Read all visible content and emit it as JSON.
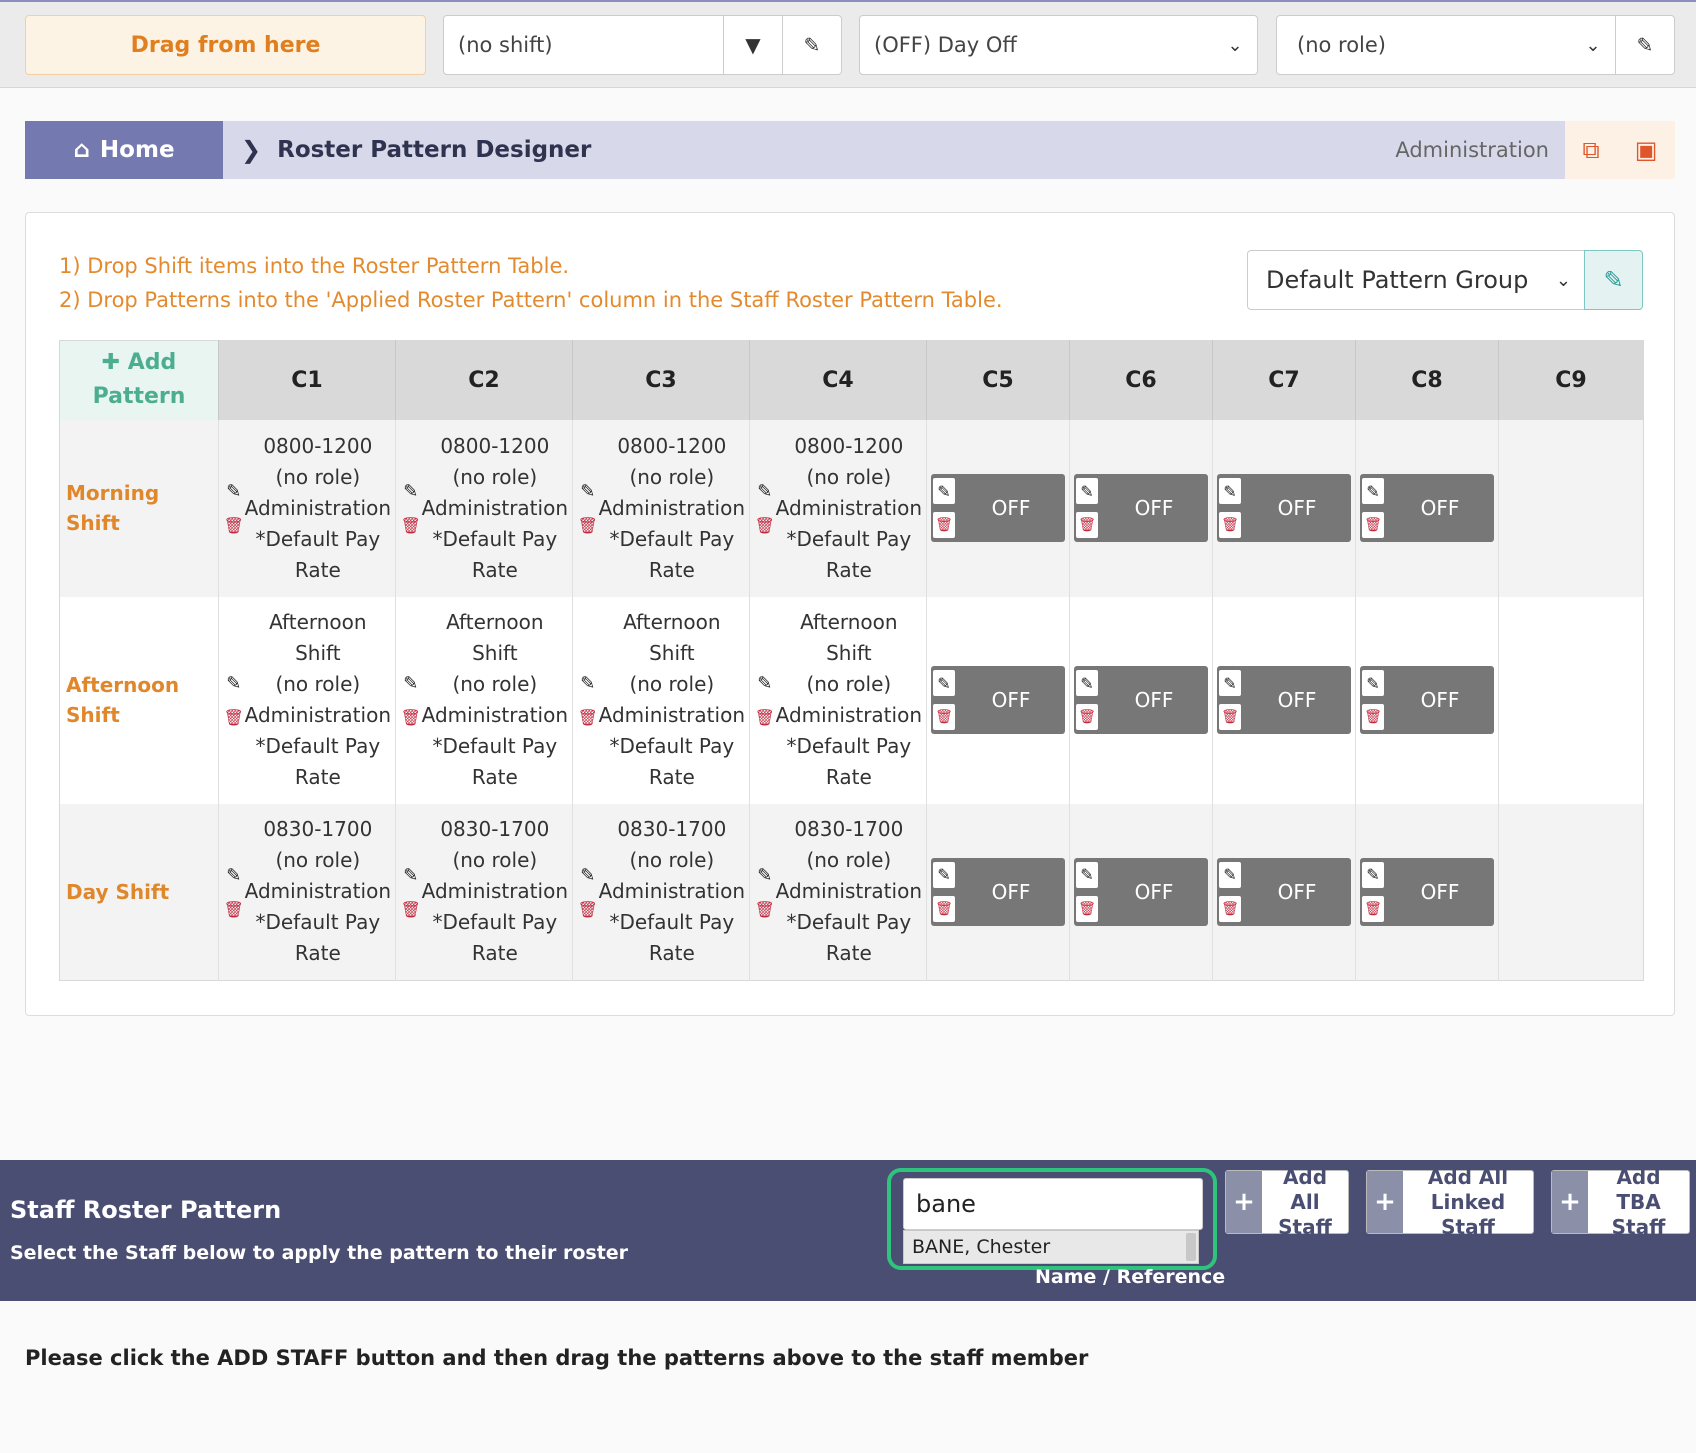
{
  "toolbar": {
    "drag_label": "Drag from here",
    "shift_value": "(no shift)",
    "day_value": "(OFF) Day Off",
    "role_value": "(no role)"
  },
  "breadcrumb": {
    "home": "Home",
    "page": "Roster Pattern Designer",
    "section": "Administration"
  },
  "instructions": {
    "line1": "1) Drop Shift items into the Roster Pattern Table.",
    "line2": "2) Drop Patterns into the 'Applied Roster Pattern' column in the Staff Roster Pattern Table."
  },
  "pattern_group": {
    "selected": "Default Pattern Group"
  },
  "table": {
    "add_pattern_line1": "Add",
    "add_pattern_line2": "Pattern",
    "columns": [
      "C1",
      "C2",
      "C3",
      "C4",
      "C5",
      "C6",
      "C7",
      "C8",
      "C9"
    ],
    "rows": [
      {
        "label": "Morning Shift",
        "shift_lines": [
          "0800-1200",
          "(no role)",
          "Administration",
          "*Default Pay",
          "Rate"
        ],
        "off_label": "OFF"
      },
      {
        "label": "Afternoon Shift",
        "shift_lines": [
          "Afternoon",
          "Shift",
          "(no role)",
          "Administration",
          "*Default Pay",
          "Rate"
        ],
        "off_label": "OFF"
      },
      {
        "label": "Day Shift",
        "shift_lines": [
          "0830-1700",
          "(no role)",
          "Administration",
          "*Default Pay",
          "Rate"
        ],
        "off_label": "OFF"
      }
    ]
  },
  "staff": {
    "title": "Staff Roster Pattern",
    "subtitle": "Select the Staff below to apply the pattern to their roster",
    "search_value": "bane",
    "suggestion": "BANE, Chester",
    "search_label": "Name / Reference",
    "add_all_staff_1": "Add All",
    "add_all_staff_2": "Staff",
    "add_linked_1": "Add All",
    "add_linked_2": "Linked Staff",
    "add_tba_1": "Add TBA",
    "add_tba_2": "Staff"
  },
  "bottom_message": "Please click the ADD STAFF button and then drag the patterns above to the staff member"
}
